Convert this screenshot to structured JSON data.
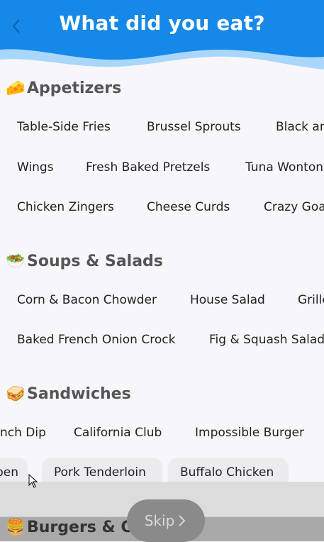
{
  "header": {
    "title": "What did you eat?",
    "back_icon": "chevron-left-icon",
    "colors": {
      "primary": "#1689e8",
      "wave_light": "#a9d7fb"
    }
  },
  "sections": [
    {
      "title": "Appetizers",
      "emoji": "🧀",
      "rows": [
        [
          "Table-Side Fries",
          "Brussel Sprouts",
          "Black an"
        ],
        [
          "Wings",
          "Fresh Baked Pretzels",
          "Tuna Wonton"
        ],
        [
          "Chicken Zingers",
          "Cheese Curds",
          "Crazy Goa"
        ]
      ]
    },
    {
      "title": "Soups & Salads",
      "emoji": "🥗",
      "rows": [
        [
          "Corn & Bacon Chowder",
          "House Salad",
          "Grille"
        ],
        [
          "Baked French Onion Crock",
          "Fig & Squash Salad"
        ]
      ]
    },
    {
      "title": "Sandwiches",
      "emoji": "🥪",
      "rows": [
        [
          "nch Dip",
          "California Club",
          "Impossible Burger"
        ],
        [
          "ben",
          "Pork Tenderloin",
          "Buffalo Chicken"
        ]
      ]
    },
    {
      "title": "Burgers & Ch",
      "emoji": "🍔"
    }
  ],
  "skip_button": {
    "label": "Skip",
    "icon": "chevron-right-icon"
  }
}
